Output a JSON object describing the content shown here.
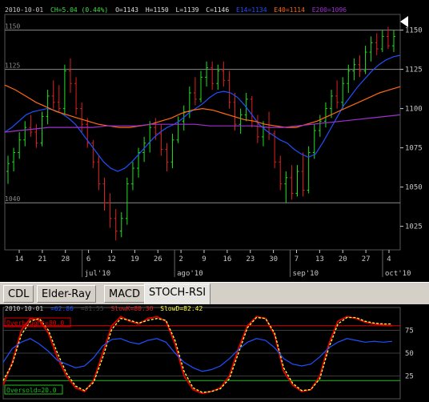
{
  "tabs": [
    {
      "label": "CDL",
      "active": false
    },
    {
      "label": "Elder-Ray",
      "active": false
    },
    {
      "label": "MACD",
      "active": false
    },
    {
      "label": "STOCH-RSI",
      "active": true
    }
  ],
  "main_header": {
    "date": "2010-10-01",
    "change": "CH=5.04 (0.44%)",
    "open": "O=1143",
    "high": "H=1150",
    "low": "L=1139",
    "close": "C=1146",
    "ema14": "E14=1134",
    "ema40": "E40=1114",
    "ema200": "E200=1096"
  },
  "osc_header": {
    "date": "2010-10-01",
    "rsi": "=62.86",
    "faded": "=81.55",
    "slowk": "SlowK=80.30",
    "slowd": "SlowD=82.42",
    "overbought": "Overbought=80.0",
    "oversold": "Oversold=20.0"
  },
  "colors": {
    "background": "#000000",
    "grid": "#3a3a3a",
    "up_bar": "#20e020",
    "down_bar": "#e02020",
    "ema14": "#2050ff",
    "ema40": "#ff6a10",
    "ema200": "#a030d0",
    "slowk": "#e00000",
    "slowd": "#ffff40",
    "rsi": "#2050ff",
    "threshold_ob": "#e00000",
    "threshold_os": "#20c020",
    "axis_text": "#c8c8c8"
  },
  "chart_data": [
    {
      "type": "ohlc",
      "y_ticks": [
        1025,
        1050,
        1075,
        1100,
        1125,
        1150
      ],
      "ylim": [
        1010,
        1160
      ],
      "reference_lines": [
        {
          "value": 1150,
          "label": "1150"
        },
        {
          "value": 1125,
          "label": "1125"
        },
        {
          "value": 1040,
          "label": "1040"
        }
      ],
      "x_ticks": [
        "14",
        "21",
        "28",
        "6",
        "12",
        "19",
        "26",
        "2",
        "9",
        "16",
        "23",
        "30",
        "7",
        "13",
        "20",
        "27",
        "4"
      ],
      "x_month_labels": [
        {
          "label": "jul'10",
          "at_tick": 3
        },
        {
          "label": "ago'10",
          "at_tick": 7
        },
        {
          "label": "sep'10",
          "at_tick": 12
        },
        {
          "label": "oct'10",
          "at_tick": 16
        }
      ],
      "bars": [
        [
          1060,
          1070,
          1052,
          1065
        ],
        [
          1066,
          1075,
          1060,
          1072
        ],
        [
          1072,
          1085,
          1068,
          1080
        ],
        [
          1080,
          1092,
          1076,
          1088
        ],
        [
          1088,
          1096,
          1082,
          1085
        ],
        [
          1085,
          1090,
          1075,
          1078
        ],
        [
          1078,
          1098,
          1076,
          1095
        ],
        [
          1095,
          1112,
          1090,
          1108
        ],
        [
          1108,
          1118,
          1100,
          1104
        ],
        [
          1104,
          1115,
          1098,
          1100
        ],
        [
          1100,
          1128,
          1096,
          1124
        ],
        [
          1124,
          1132,
          1110,
          1116
        ],
        [
          1116,
          1120,
          1096,
          1100
        ],
        [
          1100,
          1104,
          1085,
          1090
        ],
        [
          1090,
          1094,
          1075,
          1078
        ],
        [
          1078,
          1080,
          1062,
          1066
        ],
        [
          1066,
          1070,
          1048,
          1052
        ],
        [
          1052,
          1056,
          1035,
          1040
        ],
        [
          1040,
          1046,
          1024,
          1030
        ],
        [
          1030,
          1036,
          1016,
          1022
        ],
        [
          1022,
          1034,
          1018,
          1030
        ],
        [
          1030,
          1056,
          1026,
          1052
        ],
        [
          1052,
          1066,
          1048,
          1062
        ],
        [
          1062,
          1075,
          1056,
          1072
        ],
        [
          1072,
          1082,
          1066,
          1078
        ],
        [
          1078,
          1092,
          1072,
          1088
        ],
        [
          1088,
          1094,
          1080,
          1084
        ],
        [
          1084,
          1090,
          1070,
          1074
        ],
        [
          1074,
          1078,
          1060,
          1066
        ],
        [
          1066,
          1084,
          1062,
          1080
        ],
        [
          1080,
          1095,
          1078,
          1092
        ],
        [
          1092,
          1102,
          1086,
          1098
        ],
        [
          1098,
          1114,
          1094,
          1110
        ],
        [
          1110,
          1120,
          1102,
          1106
        ],
        [
          1106,
          1124,
          1104,
          1120
        ],
        [
          1120,
          1130,
          1114,
          1126
        ],
        [
          1126,
          1130,
          1112,
          1116
        ],
        [
          1116,
          1128,
          1112,
          1124
        ],
        [
          1124,
          1130,
          1114,
          1118
        ],
        [
          1118,
          1124,
          1100,
          1104
        ],
        [
          1104,
          1110,
          1086,
          1090
        ],
        [
          1090,
          1100,
          1084,
          1096
        ],
        [
          1096,
          1110,
          1092,
          1106
        ],
        [
          1106,
          1108,
          1088,
          1092
        ],
        [
          1092,
          1096,
          1078,
          1082
        ],
        [
          1082,
          1092,
          1076,
          1088
        ],
        [
          1088,
          1098,
          1080,
          1084
        ],
        [
          1084,
          1086,
          1062,
          1066
        ],
        [
          1066,
          1070,
          1048,
          1052
        ],
        [
          1052,
          1060,
          1040,
          1056
        ],
        [
          1056,
          1064,
          1042,
          1046
        ],
        [
          1046,
          1064,
          1044,
          1060
        ],
        [
          1060,
          1072,
          1044,
          1048
        ],
        [
          1048,
          1076,
          1046,
          1072
        ],
        [
          1072,
          1090,
          1068,
          1086
        ],
        [
          1086,
          1096,
          1082,
          1092
        ],
        [
          1092,
          1104,
          1088,
          1100
        ],
        [
          1100,
          1112,
          1094,
          1108
        ],
        [
          1108,
          1118,
          1100,
          1104
        ],
        [
          1104,
          1120,
          1100,
          1116
        ],
        [
          1116,
          1128,
          1110,
          1124
        ],
        [
          1124,
          1132,
          1118,
          1128
        ],
        [
          1128,
          1134,
          1120,
          1124
        ],
        [
          1124,
          1140,
          1122,
          1136
        ],
        [
          1136,
          1146,
          1130,
          1142
        ],
        [
          1142,
          1148,
          1134,
          1138
        ],
        [
          1138,
          1150,
          1136,
          1146
        ],
        [
          1146,
          1152,
          1138,
          1140
        ],
        [
          1140,
          1150,
          1136,
          1146
        ]
      ],
      "series": [
        {
          "name": "E14",
          "values": [
            1085,
            1088,
            1092,
            1096,
            1098,
            1099,
            1100,
            1099,
            1097,
            1094,
            1090,
            1084,
            1078,
            1072,
            1066,
            1062,
            1060,
            1062,
            1066,
            1071,
            1076,
            1081,
            1085,
            1088,
            1090,
            1093,
            1097,
            1100,
            1103,
            1107,
            1110,
            1111,
            1110,
            1107,
            1102,
            1096,
            1090,
            1086,
            1083,
            1080,
            1078,
            1074,
            1071,
            1069,
            1071,
            1078,
            1086,
            1094,
            1102,
            1108,
            1114,
            1119,
            1124,
            1128,
            1131,
            1133,
            1134
          ]
        },
        {
          "name": "E40",
          "values": [
            1115,
            1112,
            1108,
            1104,
            1101,
            1098,
            1096,
            1094,
            1092,
            1090,
            1089,
            1088,
            1088,
            1089,
            1090,
            1092,
            1094,
            1097,
            1099,
            1100,
            1099,
            1097,
            1095,
            1093,
            1092,
            1090,
            1089,
            1088,
            1088,
            1090,
            1092,
            1095,
            1098,
            1101,
            1104,
            1107,
            1110,
            1112,
            1114
          ]
        },
        {
          "name": "E200",
          "values": [
            1085,
            1086,
            1087,
            1088,
            1088,
            1088,
            1088,
            1089,
            1089,
            1089,
            1090,
            1090,
            1090,
            1090,
            1089,
            1089,
            1089,
            1089,
            1088,
            1088,
            1089,
            1090,
            1091,
            1092,
            1093,
            1094,
            1095,
            1096
          ]
        }
      ]
    },
    {
      "type": "line",
      "y_ticks": [
        25,
        50,
        75
      ],
      "ylim": [
        0,
        100
      ],
      "thresholds": [
        80,
        20
      ],
      "series": [
        {
          "name": "SlowK",
          "values": [
            15,
            40,
            75,
            88,
            86,
            72,
            45,
            25,
            12,
            8,
            20,
            50,
            80,
            90,
            85,
            82,
            88,
            90,
            85,
            60,
            25,
            10,
            6,
            8,
            12,
            25,
            55,
            80,
            90,
            88,
            70,
            30,
            15,
            8,
            10,
            25,
            60,
            85,
            90,
            88,
            84,
            82,
            81,
            80
          ]
        },
        {
          "name": "SlowD",
          "values": [
            20,
            38,
            70,
            85,
            88,
            75,
            50,
            28,
            14,
            9,
            18,
            45,
            76,
            88,
            86,
            83,
            86,
            88,
            86,
            64,
            30,
            12,
            7,
            8,
            11,
            22,
            50,
            78,
            89,
            88,
            72,
            34,
            17,
            9,
            10,
            22,
            56,
            82,
            89,
            89,
            85,
            83,
            82,
            82
          ]
        },
        {
          "name": "RSI",
          "values": [
            40,
            55,
            62,
            66,
            60,
            52,
            42,
            38,
            34,
            36,
            45,
            58,
            65,
            66,
            62,
            60,
            64,
            66,
            62,
            50,
            40,
            34,
            30,
            32,
            36,
            44,
            54,
            62,
            66,
            64,
            56,
            44,
            38,
            36,
            38,
            46,
            56,
            62,
            66,
            64,
            62,
            63,
            62,
            63
          ]
        }
      ]
    }
  ]
}
